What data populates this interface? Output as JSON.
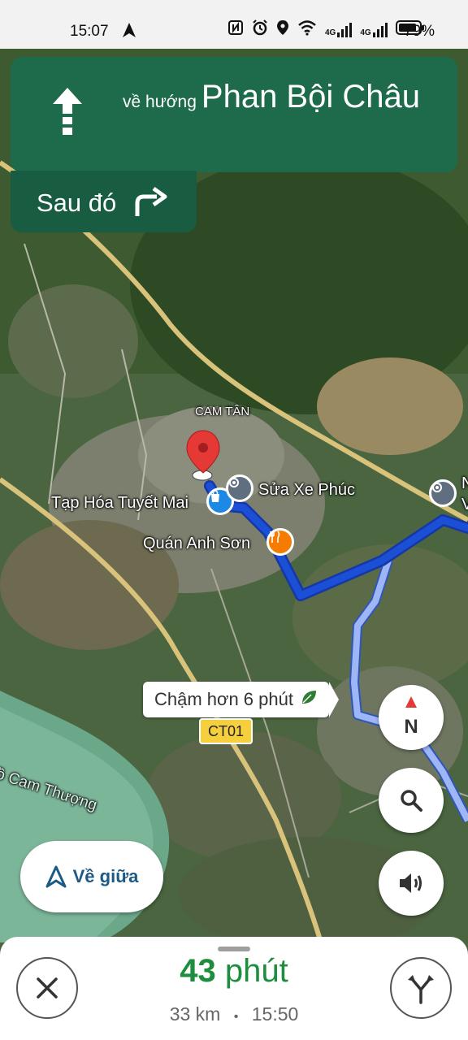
{
  "status_bar": {
    "time": "15:07",
    "battery_percent": "79%",
    "network_1": "4G",
    "network_2": "4G"
  },
  "banner": {
    "toward_prefix": "về hướng",
    "street": "Phan Bội Châu",
    "then_label": "Sau đó"
  },
  "map": {
    "area_label": "CAM TÂN",
    "poi_1": "Tạp Hóa Tuyết Mai",
    "poi_2": "Sửa Xe Phúc",
    "poi_3": "Quán Anh Sơn",
    "poi_4_partial": "N",
    "poi_4_partial_2": "V",
    "lake_label": "hồ Cam Thượng",
    "route_shield": "CT01",
    "alt_callout": "Chậm hơn 6 phút"
  },
  "controls": {
    "recenter_label": "Về giữa",
    "compass_label": "N"
  },
  "sheet": {
    "eta_number": "43",
    "eta_unit": "phút",
    "distance": "33 km",
    "separator": "•",
    "arrival_time": "15:50"
  },
  "colors": {
    "banner_green": "#1e6b4c",
    "eta_green": "#1e8e3e",
    "route_blue": "#1a4fd6",
    "alt_route": "#9eb6f5"
  }
}
